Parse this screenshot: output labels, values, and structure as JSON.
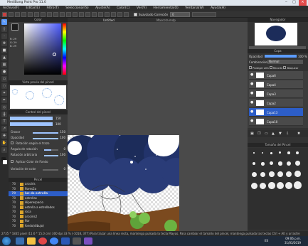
{
  "title": "MediBang Paint Pro 11.0",
  "menu": [
    "Archivo(F)",
    "Editar(E)",
    "Filtro(T)",
    "Seleccionar(S)",
    "Ajuste(A)",
    "Color(C)",
    "Ver(V)",
    "Herramienta(O)",
    "Ventana(W)",
    "Ayuda(H)"
  ],
  "toolbar": {
    "smoothing_label": "Suavizado",
    "correction_label": "Correción",
    "correction_value": "0"
  },
  "panels": {
    "color": "Color",
    "brush_preview": "Vista previa del pincel",
    "brush_control": "Control del pincel",
    "brush": "Pincel",
    "tab_canvas": "Untitled",
    "tab_other": "Mascota.mdp",
    "navigator": "Navegador",
    "layer": "Capa",
    "brush_size": "Tamaño del Pincel"
  },
  "color_values": {
    "h": "R: 29",
    "s": "G: 29",
    "v": "B: 29"
  },
  "brush_control": {
    "grosor_label": "Grosor",
    "grosor_value": "150",
    "opacidad_label": "Opacidad",
    "opacidad_value": "100",
    "rotacion_trazo_label": "Rotación según el trazo",
    "angulo_label": "Ángulo de rotación",
    "angulo_value": "0",
    "rotacion_arbitraria_label": "Rotación arbitraria",
    "rotacion_arbitraria_value": "100",
    "color_fondo_label": "Aplicar Color de Fondo",
    "variacion_label": "Variación de color",
    "variacion_value": "0"
  },
  "brush_list": [
    {
      "num": "70",
      "name": "arcoiris"
    },
    {
      "num": "70",
      "name": "flores2a"
    },
    {
      "num": "70",
      "name": "luz de estrella"
    },
    {
      "num": "70",
      "name": "estrellas"
    },
    {
      "num": "70",
      "name": "Hiperespacio"
    },
    {
      "num": "70",
      "name": "estrella a estrellados"
    },
    {
      "num": "70",
      "name": "roca"
    },
    {
      "num": "70",
      "name": "arcoiris2"
    },
    {
      "num": "70",
      "name": "flor"
    },
    {
      "num": "70",
      "name": "fondo(dibujo)"
    }
  ],
  "layer": {
    "opacity_label": "Opacidad",
    "opacity_value": "100 %",
    "blend_label": "Combinación",
    "blend_value": "Normal",
    "protect_alpha": "Proteger alfa",
    "clip": "Recorte",
    "lock": "Bloquear",
    "layers": [
      "Capa6",
      "Capa4",
      "Capa3",
      "Capa2",
      "Capa13",
      "Capa10"
    ]
  },
  "status": "2735 * 1835 pixel  (11.6 * 15.0 cm)  300 dpi  33 %  (-1018, 377)  Para trazar una línea recta, mantenga pulsada la tecla Mayús. Para cambiar el tamaño del pincel, mantenga pulsada las teclas Ctrl + Alt y arrastre",
  "taskbar": {
    "lang": "ES",
    "time": "09:06 p.m.",
    "date": "31/03/2019"
  },
  "colors": {
    "accent": "#5b9bff",
    "navy": "#1c2c5a",
    "dirt": "#7b4a1f"
  }
}
